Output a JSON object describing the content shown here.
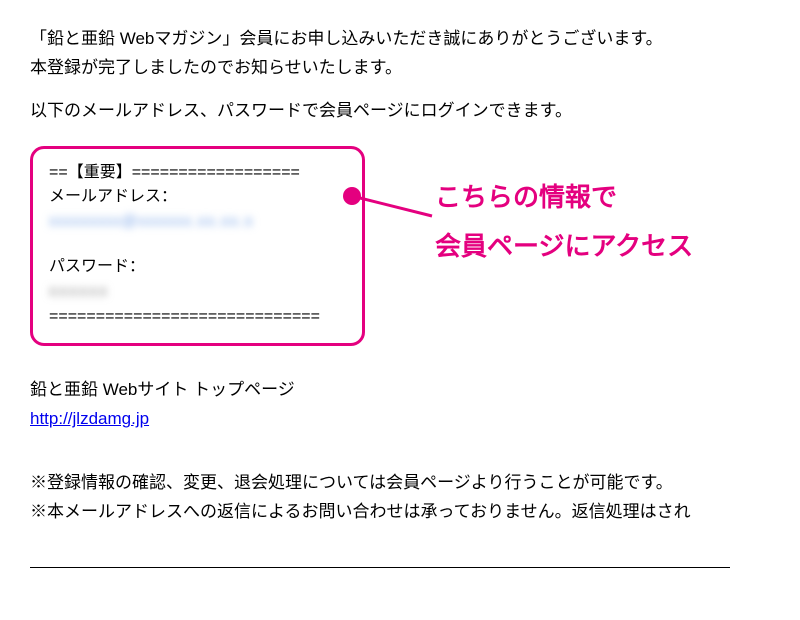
{
  "intro": {
    "line1": "「鉛と亜鉛 Webマガジン」会員にお申し込みいただき誠にありがとうございます。",
    "line2": "本登録が完了しましたのでお知らせいたします。"
  },
  "login_note": "以下のメールアドレス、パスワードで会員ページにログインできます。",
  "important": {
    "sep_top": "==【重要】==================",
    "email_label": "メールアドレス：",
    "email_blurred": "xxxxxxxx@xxxxxx.xx.xx.x",
    "password_label": "パスワード：",
    "password_blurred": "xxxxxx",
    "sep_bottom": "============================="
  },
  "callout": {
    "line1": "こちらの情報で",
    "line2": "会員ページにアクセス"
  },
  "site": {
    "label": "鉛と亜鉛 Webサイト トップページ",
    "url": "http://jlzdamg.jp"
  },
  "notes": {
    "note1": "※登録情報の確認、変更、退会処理については会員ページより行うことが可能です。",
    "note2": "※本メールアドレスへの返信によるお問い合わせは承っておりません。返信処理はされ"
  }
}
